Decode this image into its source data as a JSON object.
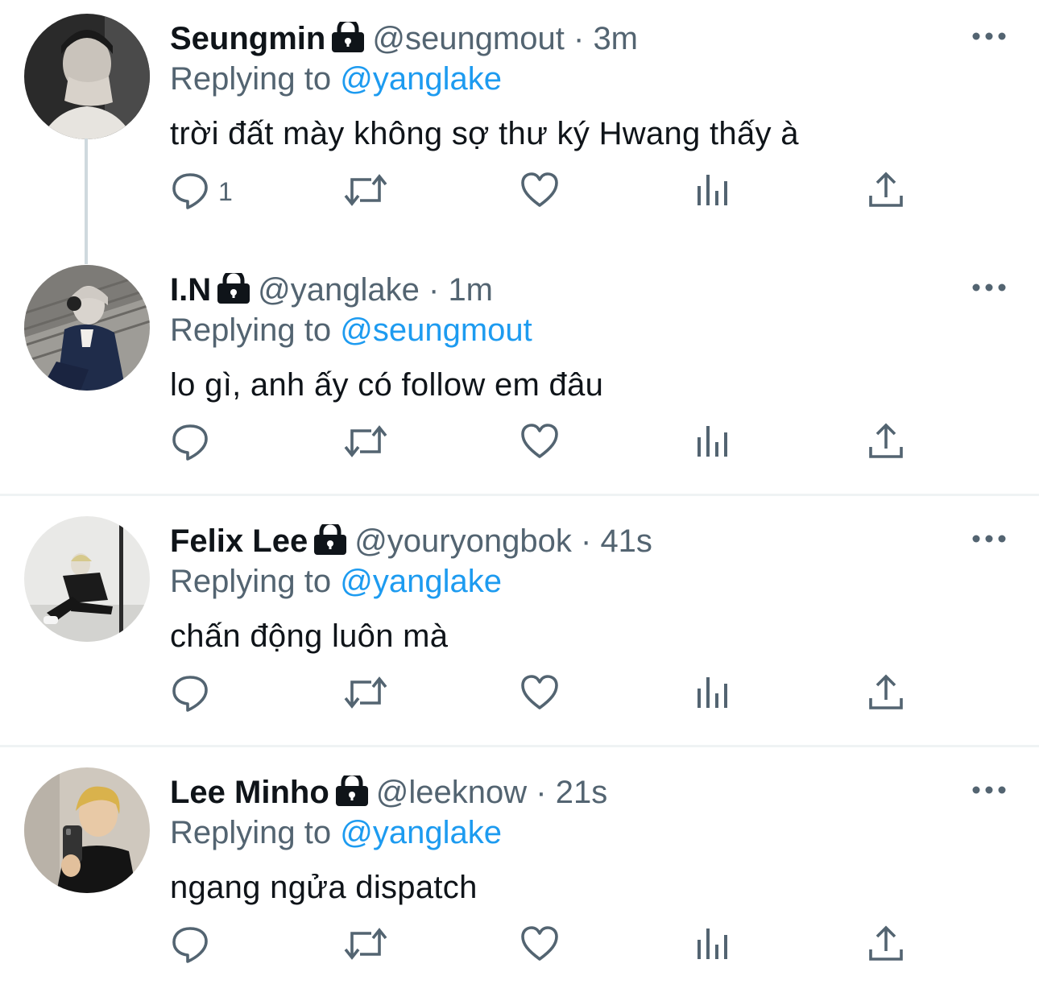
{
  "colors": {
    "accent": "#1d9bf0",
    "secondary_text": "#536471",
    "primary_text": "#0f1419"
  },
  "tweets": [
    {
      "name": "Seungmin",
      "handle": "@seungmout",
      "dot": "·",
      "time": "3m",
      "replying_prefix": "Replying to",
      "replying_to": "@yanglake",
      "text": "trời đất mày không sợ thư ký Hwang thấy à",
      "reply_count": "1",
      "protected_icon": "lock-icon"
    },
    {
      "name": "I.N",
      "handle": "@yanglake",
      "dot": "·",
      "time": "1m",
      "replying_prefix": "Replying to",
      "replying_to": "@seungmout",
      "text": "lo gì, anh ấy có follow em đâu",
      "reply_count": "",
      "protected_icon": "lock-icon"
    },
    {
      "name": "Felix Lee",
      "handle": "@youryongbok",
      "dot": "·",
      "time": "41s",
      "replying_prefix": "Replying to",
      "replying_to": "@yanglake",
      "text": "chấn động luôn mà",
      "reply_count": "",
      "protected_icon": "lock-icon"
    },
    {
      "name": "Lee Minho",
      "handle": "@leeknow",
      "dot": "·",
      "time": "21s",
      "replying_prefix": "Replying to",
      "replying_to": "@yanglake",
      "text": "ngang ngửa dispatch",
      "reply_count": "",
      "protected_icon": "lock-icon"
    }
  ],
  "action_icons": [
    "reply-icon",
    "retweet-icon",
    "like-icon",
    "analytics-icon",
    "share-icon"
  ]
}
